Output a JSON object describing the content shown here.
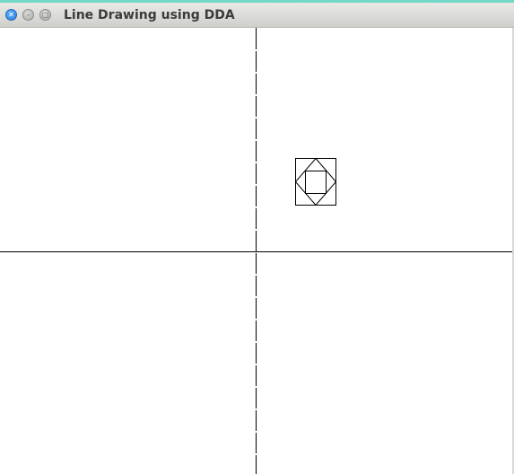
{
  "window": {
    "title": "Line Drawing using DDA",
    "controls": {
      "close_icon": "close-icon",
      "minimize_icon": "minimize-icon",
      "maximize_icon": "maximize-icon"
    },
    "accent_color": "#74d6c7"
  },
  "canvas": {
    "background": "#ffffff",
    "stroke_color": "#000000"
  }
}
